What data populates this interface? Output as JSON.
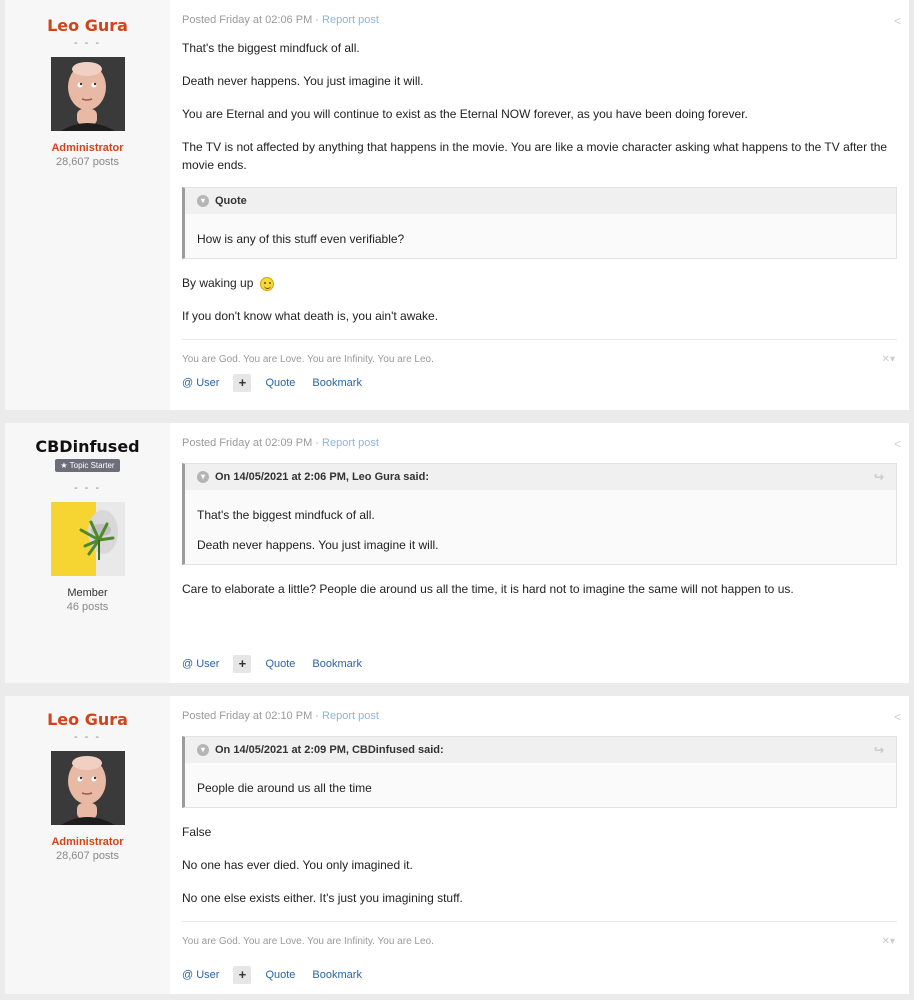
{
  "posts": [
    {
      "author": "Leo Gura",
      "title": "- - -",
      "group": "Administrator",
      "post_count": "28,607 posts",
      "meta_time": "Posted Friday at 02:06 PM",
      "meta_sep": " · ",
      "report": "Report post",
      "paragraphs_before": [
        "That's the biggest mindfuck of all.",
        "Death never happens. You just imagine it will.",
        "You are Eternal and you will continue to exist as the Eternal NOW forever, as you have been doing forever.",
        "The TV is not affected by anything that happens in the movie. You are like a movie character asking what happens to the TV after the movie ends."
      ],
      "quote_head": "Quote",
      "quote_lines": [
        "How is any of this stuff even verifiable?"
      ],
      "paragraph_emoji": "By waking up",
      "paragraph_last": "If you don't know what death is, you ain't awake.",
      "signature": "You are God. You are Love. You are Infinity. You are Leo."
    },
    {
      "author": "CBDinfused",
      "badge": "★ Topic Starter",
      "title": "- - -",
      "group": "Member",
      "post_count": "46 posts",
      "meta_time": "Posted Friday at 02:09 PM",
      "meta_sep": " · ",
      "report": "Report post",
      "quote_head": "On 14/05/2021 at 2:06 PM, Leo Gura said:",
      "quote_lines": [
        "That's the biggest mindfuck of all.",
        "Death never happens. You just imagine it will."
      ],
      "paragraphs_after": [
        "Care to elaborate a little? People die around us all the time, it is hard not to imagine the same will not happen to us."
      ]
    },
    {
      "author": "Leo Gura",
      "title": "- - -",
      "group": "Administrator",
      "post_count": "28,607 posts",
      "meta_time": "Posted Friday at 02:10 PM",
      "meta_sep": " · ",
      "report": "Report post",
      "quote_head": "On 14/05/2021 at 2:09 PM, CBDinfused said:",
      "quote_lines": [
        "People die around us all the time"
      ],
      "paragraphs_after": [
        "False",
        "No one has ever died. You only imagined it.",
        "No one else exists either. It's just you imagining stuff."
      ],
      "signature": "You are God. You are Love. You are Infinity. You are Leo."
    }
  ],
  "actions": {
    "user": "@ User",
    "plus": "+",
    "quote": "Quote",
    "bookmark": "Bookmark"
  },
  "icons": {
    "share": "share-icon",
    "chevron": "chevron-down-icon",
    "reply": "reply-arrow-icon",
    "close": "close-icon",
    "emoji": "smiley-emoji-icon"
  },
  "colors": {
    "admin": "#d3431a",
    "link": "#2b63a8",
    "page_bg": "#ebebeb"
  }
}
